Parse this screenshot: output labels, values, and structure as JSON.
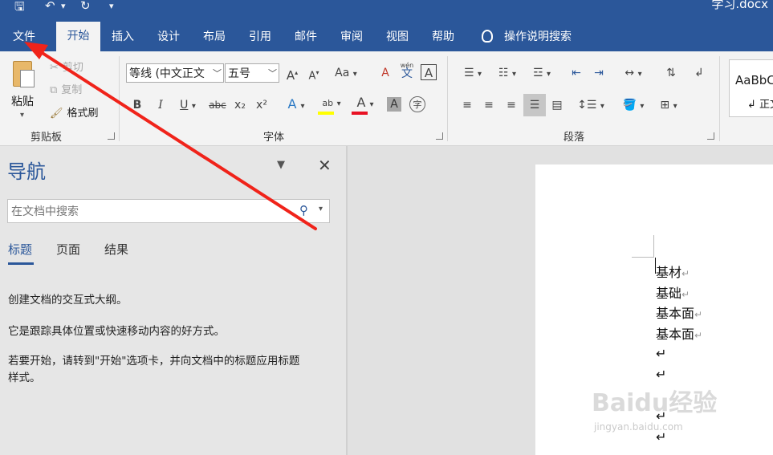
{
  "window": {
    "title": "学习.docx"
  },
  "tabs": [
    {
      "label": "文件"
    },
    {
      "label": "开始"
    },
    {
      "label": "插入"
    },
    {
      "label": "设计"
    },
    {
      "label": "布局"
    },
    {
      "label": "引用"
    },
    {
      "label": "邮件"
    },
    {
      "label": "审阅"
    },
    {
      "label": "视图"
    },
    {
      "label": "帮助"
    }
  ],
  "tell_me": "操作说明搜索",
  "clipboard": {
    "paste": "粘贴",
    "cut": "剪切",
    "copy": "复制",
    "format_painter": "格式刷",
    "group_label": "剪贴板"
  },
  "font": {
    "font_name": "等线 (中文正文",
    "font_size": "五号",
    "group_label": "字体",
    "grow": "A",
    "shrink": "A",
    "case": "Aa",
    "clear": "A",
    "phonetic": "wén",
    "phonetic_char": "文",
    "border_char": "A",
    "bold": "B",
    "italic": "I",
    "underline": "U",
    "strike": "abc",
    "subscript": "x₂",
    "superscript": "x²",
    "effects": "A",
    "highlight": "ab",
    "color": "A",
    "shading": "A",
    "enclose": "字"
  },
  "paragraph": {
    "group_label": "段落"
  },
  "styles": {
    "sample": "AaBbC",
    "name": "↲ 正文"
  },
  "nav": {
    "title": "导航",
    "search_placeholder": "在文档中搜索",
    "tabs": [
      "标题",
      "页面",
      "结果"
    ],
    "desc1": "创建文档的交互式大纲。",
    "desc2": "它是跟踪具体位置或快速移动内容的好方式。",
    "desc3_line1": "若要开始，请转到\"开始\"选项卡，并向文档中的标题应用标题",
    "desc3_line2": "样式。"
  },
  "document": {
    "lines": [
      "基材",
      "基础",
      "基本面",
      "基本面"
    ],
    "return_mark": "↵"
  },
  "watermark": {
    "brand": "Baidu经验",
    "url": "jingyan.baidu.com"
  },
  "colors": {
    "accent": "#2b579a",
    "highlight_bar": "#ffff00",
    "font_color_bar": "#e81123",
    "annotation_arrow": "#f0231a"
  }
}
